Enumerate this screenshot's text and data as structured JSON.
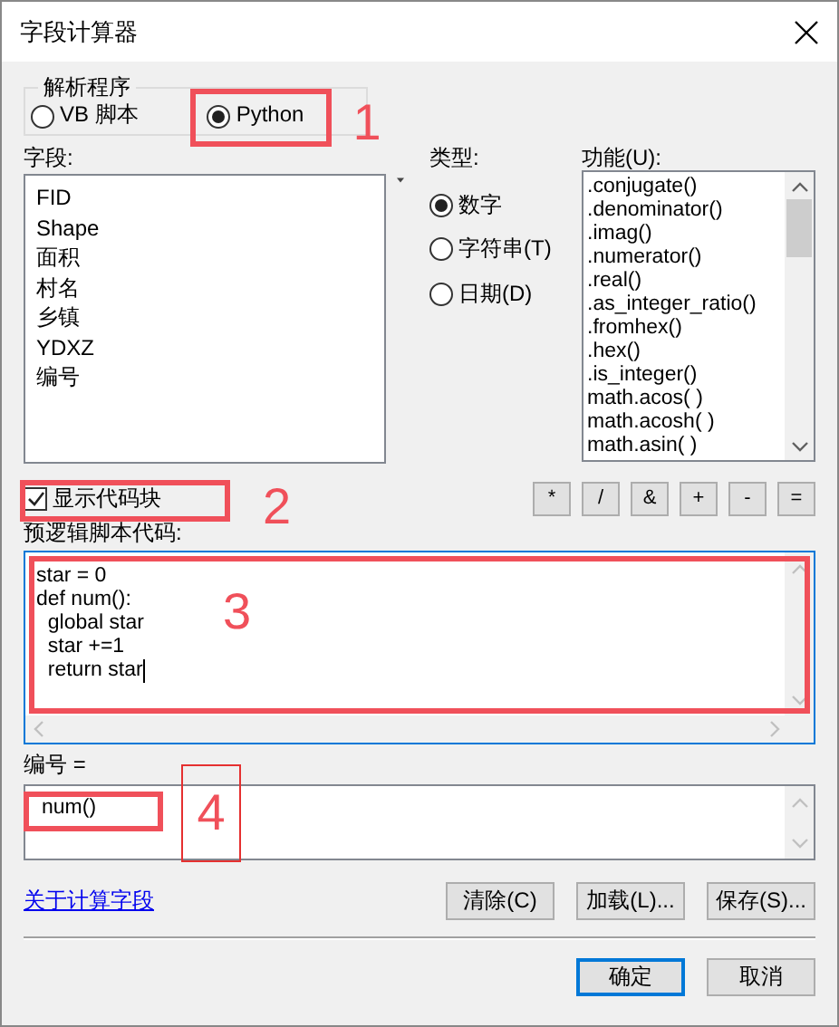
{
  "window": {
    "title": "字段计算器"
  },
  "parser": {
    "legend": "解析程序",
    "options": [
      {
        "label": "VB 脚本",
        "selected": false
      },
      {
        "label": "Python",
        "selected": true
      }
    ]
  },
  "fields": {
    "label": "字段:",
    "items": [
      "FID",
      "Shape",
      "面积",
      "村名",
      "乡镇",
      "YDXZ",
      "编号"
    ]
  },
  "type": {
    "label": "类型:",
    "options": [
      {
        "label": "数字",
        "selected": true
      },
      {
        "label": "字符串(T)",
        "selected": false
      },
      {
        "label": "日期(D)",
        "selected": false
      }
    ]
  },
  "functions": {
    "label": "功能(U):",
    "items": [
      ".conjugate()",
      ".denominator()",
      ".imag()",
      ".numerator()",
      ".real()",
      ".as_integer_ratio()",
      ".fromhex()",
      ".hex()",
      ".is_integer()",
      "math.acos( )",
      "math.acosh( )",
      "math.asin( )"
    ]
  },
  "show_codeblock": {
    "label": "显示代码块",
    "checked": true
  },
  "operators": [
    "*",
    "/",
    "&",
    "+",
    "-",
    "="
  ],
  "codeblock": {
    "label": "预逻辑脚本代码:",
    "lines": [
      "star = 0",
      "def num():",
      "  global star",
      "  star +=1",
      "  return star"
    ]
  },
  "expression": {
    "label": "编号 =",
    "value": "num()"
  },
  "help_link": "关于计算字段",
  "buttons": [
    "清除(C)",
    "加载(L)...",
    "保存(S)..."
  ],
  "dialog_buttons": [
    {
      "label": "确定",
      "default": true
    },
    {
      "label": "取消",
      "default": false
    }
  ],
  "annotations": [
    {
      "label": "1",
      "kind": "box"
    },
    {
      "label": "2",
      "kind": "box"
    },
    {
      "label": "3",
      "kind": "box"
    },
    {
      "label": "4",
      "kind": "framed"
    }
  ]
}
